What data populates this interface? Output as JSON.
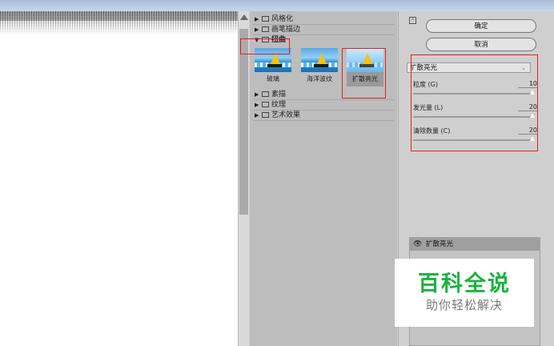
{
  "gallery": {
    "categories": [
      {
        "label": "风格化",
        "expanded": false
      },
      {
        "label": "画笔描边",
        "expanded": false
      },
      {
        "label": "扭曲",
        "expanded": true
      },
      {
        "label": "素描",
        "expanded": false
      },
      {
        "label": "纹理",
        "expanded": false
      },
      {
        "label": "艺术效果",
        "expanded": false
      }
    ],
    "distort_filters": [
      {
        "label": "玻璃",
        "selected": false
      },
      {
        "label": "海洋波纹",
        "selected": false
      },
      {
        "label": "扩散亮光",
        "selected": true
      }
    ]
  },
  "settings": {
    "ok_label": "确定",
    "cancel_label": "取消",
    "filter_select": "扩散亮光",
    "params": [
      {
        "label": "粒度 (G)",
        "value": "10",
        "level": 1.0
      },
      {
        "label": "发光量 (L)",
        "value": "20",
        "level": 1.0
      },
      {
        "label": "清除数量 (C)",
        "value": "20",
        "level": 1.0
      }
    ]
  },
  "layers": {
    "items": [
      {
        "label": "扩散亮光",
        "visible": true
      }
    ]
  },
  "watermark": {
    "title": "百科全说",
    "subtitle": "助你轻松解决"
  },
  "icons": {
    "expanded": "▼",
    "collapsed": "▶",
    "eye": "👁",
    "collapse_panel": "⌃"
  },
  "colors": {
    "highlight_box": "#e02020",
    "watermark_green": "#1ab33f"
  }
}
